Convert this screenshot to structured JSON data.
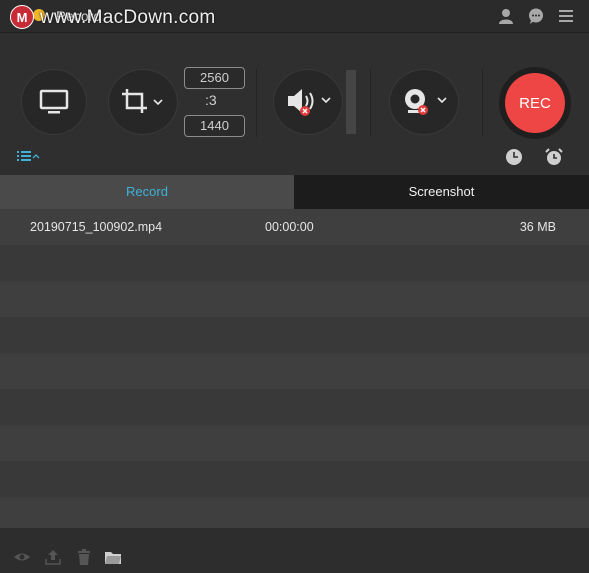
{
  "window": {
    "title": "Record",
    "watermark": "www.MacDown.com",
    "logo_letter": "M"
  },
  "toolbar": {
    "width": "2560",
    "height": "1440",
    "link_glyph": ":3",
    "rec_label": "REC"
  },
  "tabs": [
    {
      "label": "Record",
      "active": true
    },
    {
      "label": "Screenshot",
      "active": false
    }
  ],
  "recordings": [
    {
      "name": "20190715_100902.mp4",
      "duration": "00:00:00",
      "size": "36 MB"
    }
  ],
  "colors": {
    "accent": "#3fb2d8",
    "rec": "#ee4545",
    "muted_badge": "#e23b3b"
  },
  "icons": [
    "display-icon",
    "crop-icon",
    "speaker-icon",
    "webcam-icon",
    "clock-icon",
    "alarm-icon",
    "list-icon",
    "user-icon",
    "chat-icon",
    "menu-icon",
    "eye-icon",
    "upload-icon",
    "trash-icon",
    "folder-icon"
  ]
}
